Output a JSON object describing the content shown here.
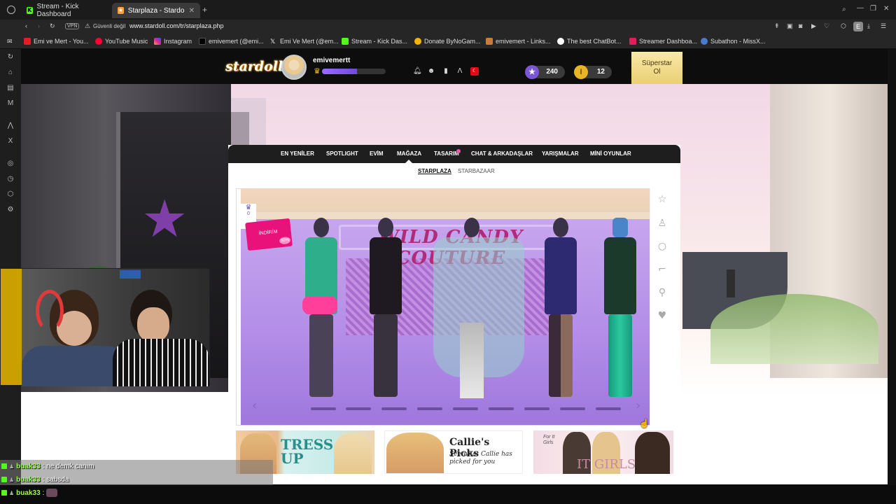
{
  "browser": {
    "tabs": [
      {
        "label": "Stream - Kick Dashboard",
        "active": false
      },
      {
        "label": "Starplaza - Stardoll | Türk",
        "active": true
      }
    ],
    "new_tab": "+",
    "vpn_label": "VPN",
    "security_label": "Güvenli değil",
    "url": "www.stardoll.com/tr/starplaza.php",
    "bookmarks": [
      "Emi ve Mert - You...",
      "YouTube Music",
      "Instagram",
      "emivemert (@emi...",
      "Emi Ve Mert (@em...",
      "Stream - Kick Das...",
      "Donate ByNoGam...",
      "emivemert - Links...",
      "The best ChatBot...",
      "Streamer Dashboa...",
      "Subathon - MissX..."
    ],
    "profile_initial": "E"
  },
  "header": {
    "logo": "stardoll",
    "username": "emivemertt",
    "xp_progress": 0.55,
    "stardollars": "240",
    "coins": "12",
    "superstar_line1": "Süperstar",
    "superstar_line2": "Ol"
  },
  "nav": {
    "items": [
      "EN YENİLER",
      "SPOTLIGHT",
      "EVİM",
      "MAĞAZA",
      "TASARIM",
      "CHAT & ARKADAŞLAR",
      "YARIŞMALAR",
      "MİNİ OYUNLAR"
    ],
    "sub": [
      "STARPLAZA",
      "STARBAZAAR"
    ]
  },
  "showcase": {
    "sign": "WILD CANDY COUTURE",
    "crown_count": "0",
    "sale_tag_text": "İNDİRİM",
    "sale_percent": "50%"
  },
  "banners": {
    "dress_up": "TRESS UP",
    "callie_title": "Callie's Picks",
    "callie_sub": "See what Callie has picked for you",
    "it_girls_small": "For It Girls",
    "it_girls": "IT GIRLS"
  },
  "chat": [
    {
      "user": "buak33",
      "message": ": ne demk canım"
    },
    {
      "user": "buak33",
      "message": ": sabsda"
    },
    {
      "user": "buak33",
      "message": ":"
    }
  ],
  "colors": {
    "kick_green": "#53fc18",
    "stardoll_purple": "#7b57d6",
    "superstar_gold": "#e9cf74"
  }
}
